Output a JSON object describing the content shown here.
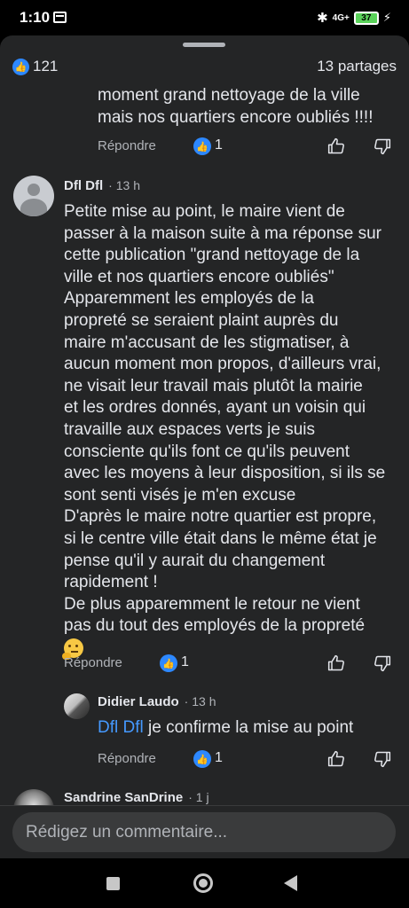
{
  "status": {
    "time": "1:10",
    "network": "4G+",
    "battery": "37"
  },
  "post": {
    "likes": "121",
    "shares": "13 partages"
  },
  "previous_comment": {
    "text_lines": [
      "moment grand nettoyage de la ville",
      "mais nos quartiers encore oubliés !!!!"
    ],
    "reply_label": "Répondre",
    "reaction_count": "1"
  },
  "comment": {
    "author": "Dfl Dfl",
    "time": "13 h",
    "text_lines": [
      "Petite mise au point, le maire vient de",
      "passer à la maison suite à ma réponse sur",
      "cette publication \"grand nettoyage de la",
      "ville et nos quartiers encore oubliés\"",
      "Apparemment les employés de la",
      "propreté se seraient plaint auprès du",
      "maire m'accusant de les stigmatiser, à",
      "aucun moment mon propos, d'ailleurs vrai,",
      "ne  visait leur travail mais plutôt la mairie",
      "et les ordres donnés, ayant un voisin qui",
      "travaille aux espaces verts je suis",
      "consciente qu'ils font ce qu'ils peuvent",
      "avec les moyens à leur disposition, si ils se",
      "sont senti visés je m'en excuse",
      "D'après le maire notre quartier est propre,",
      "si le centre ville était dans le même état je",
      "pense qu'il y aurait du changement",
      "rapidement !",
      "De plus apparemment le retour ne vient",
      "pas du tout des employés de la propreté"
    ],
    "emoji": "thinking-face",
    "reply_label": "Répondre",
    "reaction_count": "1"
  },
  "reply": {
    "author": "Didier Laudo",
    "time": "13 h",
    "mention": "Dfl Dfl",
    "text": " je confirme la mise au point",
    "reply_label": "Répondre",
    "reaction_count": "1"
  },
  "next_comment": {
    "author": "Sandrine SanDrine",
    "time": "1 j"
  },
  "composer": {
    "placeholder": "Rédigez un commentaire..."
  },
  "colors": {
    "sheet_bg": "#242526",
    "text": "#e4e6eb",
    "muted": "#b0b3b8",
    "accent": "#2d88ff",
    "mention": "#4599ff"
  }
}
